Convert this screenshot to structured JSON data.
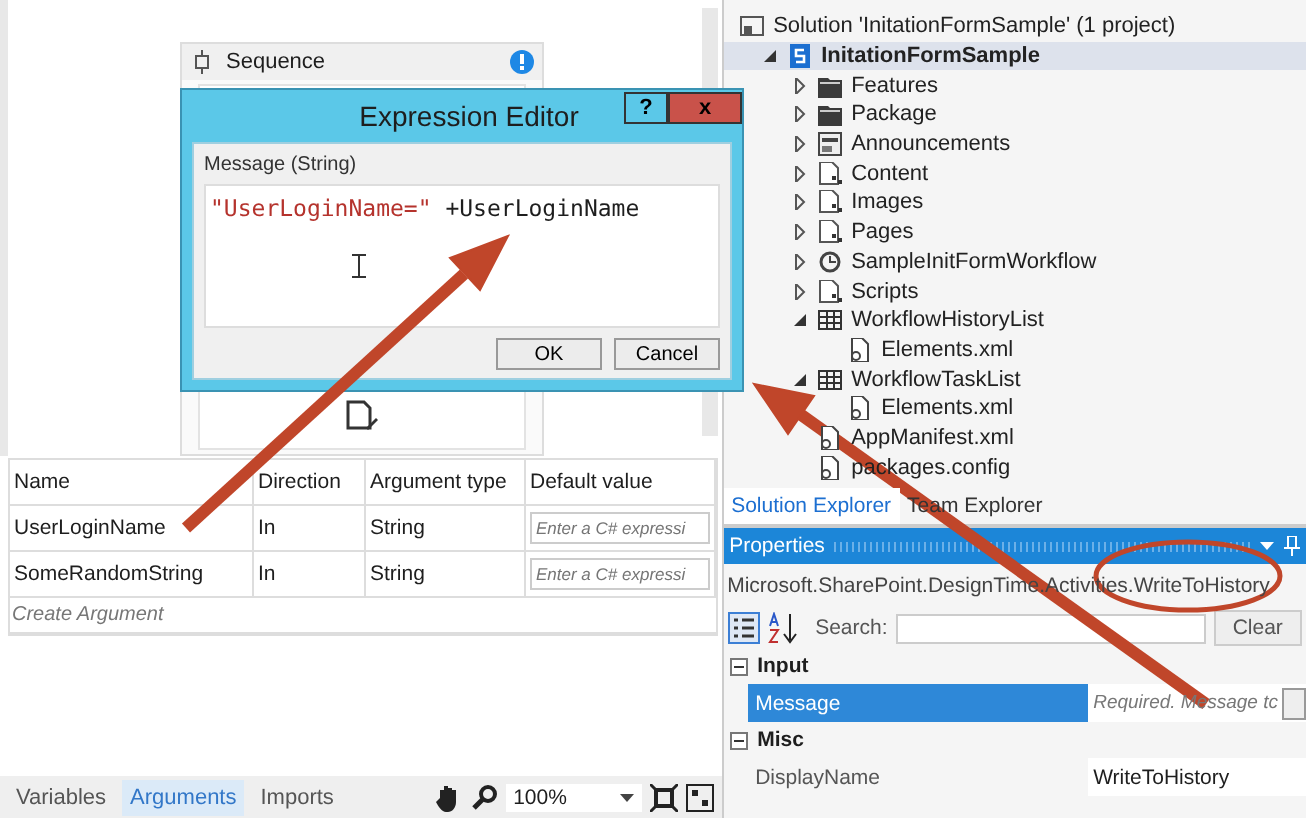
{
  "designer": {
    "sequence_title": "Sequence"
  },
  "dialog": {
    "title": "Expression Editor",
    "help": "?",
    "close": "x",
    "label": "Message (String)",
    "expression_string": "\"UserLoginName=\"",
    "expression_rest": " +UserLoginName",
    "buttons": [
      "OK",
      "Cancel"
    ]
  },
  "arguments": {
    "columns": [
      "Name",
      "Direction",
      "Argument type",
      "Default value"
    ],
    "rows": [
      {
        "name": "UserLoginName",
        "direction": "In",
        "type": "String",
        "default_placeholder": "Enter a C# expressi"
      },
      {
        "name": "SomeRandomString",
        "direction": "In",
        "type": "String",
        "default_placeholder": "Enter a C# expressi"
      }
    ],
    "create": "Create Argument"
  },
  "bottom_tabs": [
    {
      "label": "Variables",
      "selected": false
    },
    {
      "label": "Arguments",
      "selected": true
    },
    {
      "label": "Imports",
      "selected": false
    }
  ],
  "zoom": "100%",
  "solution": {
    "title": "Solution 'InitationFormSample' (1 project)",
    "items": [
      {
        "label": "InitationFormSample",
        "kind": "project",
        "expanded": true,
        "selected": true,
        "children": [
          {
            "label": "Features",
            "kind": "folder",
            "expanded": false
          },
          {
            "label": "Package",
            "kind": "folder",
            "expanded": false
          },
          {
            "label": "Announcements",
            "kind": "list",
            "expanded": false
          },
          {
            "label": "Content",
            "kind": "module",
            "expanded": false
          },
          {
            "label": "Images",
            "kind": "module",
            "expanded": false
          },
          {
            "label": "Pages",
            "kind": "module",
            "expanded": false
          },
          {
            "label": "SampleInitFormWorkflow",
            "kind": "workflow",
            "expanded": false
          },
          {
            "label": "Scripts",
            "kind": "module",
            "expanded": false
          },
          {
            "label": "WorkflowHistoryList",
            "kind": "table",
            "expanded": true,
            "children": [
              {
                "label": "Elements.xml",
                "kind": "file"
              }
            ]
          },
          {
            "label": "WorkflowTaskList",
            "kind": "table",
            "expanded": true,
            "children": [
              {
                "label": "Elements.xml",
                "kind": "file"
              }
            ]
          },
          {
            "label": "AppManifest.xml",
            "kind": "file"
          },
          {
            "label": "packages.config",
            "kind": "file"
          }
        ]
      }
    ]
  },
  "explorer_tabs": [
    {
      "label": "Solution Explorer",
      "selected": true
    },
    {
      "label": "Team Explorer",
      "selected": false
    }
  ],
  "properties": {
    "title": "Properties",
    "object": "Microsoft.SharePoint.DesignTime.Activities.WriteToHistory",
    "search_label": "Search:",
    "clear": "Clear",
    "categories": [
      {
        "name": "Input",
        "expanded": true,
        "rows": [
          {
            "name": "Message",
            "value": "Required. Message tc",
            "selected": true,
            "placeholder": true
          }
        ]
      },
      {
        "name": "Misc",
        "expanded": true,
        "rows": [
          {
            "name": "DisplayName",
            "value": "WriteToHistory",
            "selected": false,
            "placeholder": false
          }
        ]
      }
    ]
  }
}
